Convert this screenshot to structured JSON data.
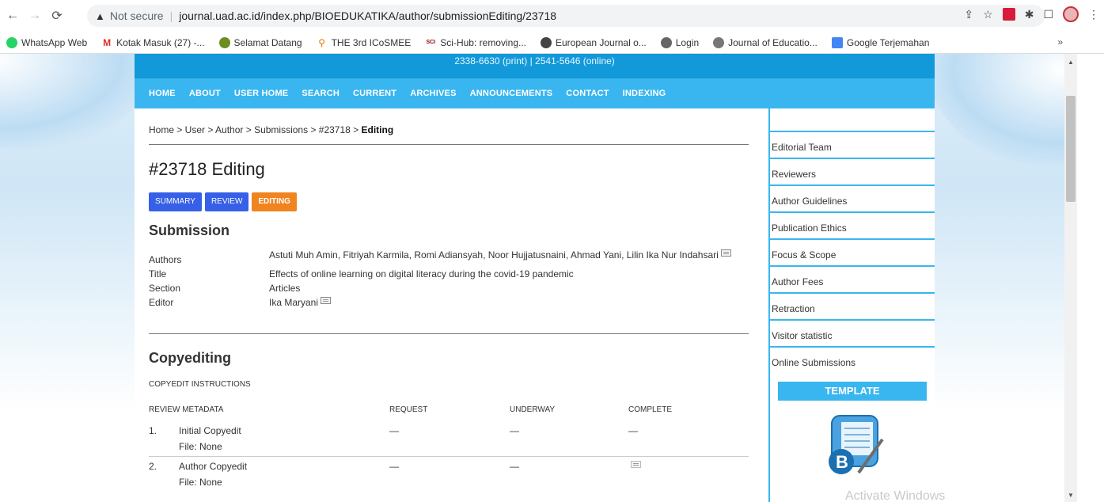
{
  "browser": {
    "security_warning": "Not secure",
    "url": "journal.uad.ac.id/index.php/BIOEDUKATIKA/author/submissionEditing/23718",
    "bookmarks": [
      "WhatsApp Web",
      "Kotak Masuk (27) -...",
      "Selamat Datang",
      "THE 3rd ICoSMEE",
      "Sci-Hub: removing...",
      "European Journal o...",
      "Login",
      "Journal of Educatio...",
      "Google Terjemahan"
    ],
    "more": "»"
  },
  "header": {
    "issn": "2338-6630 (print) | 2541-5646 (online)"
  },
  "nav": [
    "HOME",
    "ABOUT",
    "USER HOME",
    "SEARCH",
    "CURRENT",
    "ARCHIVES",
    "ANNOUNCEMENTS",
    "CONTACT",
    "INDEXING"
  ],
  "breadcrumb": {
    "path": "Home > User > Author > Submissions > #23718 > ",
    "current": "Editing"
  },
  "page_title": "#23718 Editing",
  "tabs": [
    "SUMMARY",
    "REVIEW",
    "EDITING"
  ],
  "submission": {
    "heading": "Submission",
    "authors_label": "Authors",
    "authors_value": "Astuti Muh Amin, Fitriyah Karmila, Romi Adiansyah, Noor Hujjatusnaini, Ahmad Yani, Lilin Ika Nur Indahsari",
    "title_label": "Title",
    "title_value": "Effects of online learning on digital literacy during the covid-19 pandemic",
    "section_label": "Section",
    "section_value": "Articles",
    "editor_label": "Editor",
    "editor_value": "Ika Maryani"
  },
  "copyediting": {
    "heading": "Copyediting",
    "instructions": "COPYEDIT INSTRUCTIONS",
    "col_review": "REVIEW METADATA",
    "col_request": "REQUEST",
    "col_underway": "UNDERWAY",
    "col_complete": "COMPLETE",
    "rows": [
      {
        "num": "1.",
        "name": "Initial Copyedit",
        "request": "—",
        "underway": "—",
        "complete": "—",
        "file": "File: None"
      },
      {
        "num": "2.",
        "name": "Author Copyedit",
        "request": "—",
        "underway": "—",
        "complete": "",
        "file": "File: None"
      }
    ]
  },
  "sidebar": {
    "items": [
      "Editorial Team",
      "Reviewers",
      "Author Guidelines",
      "Publication Ethics",
      "Focus & Scope",
      "Author Fees",
      "Retraction",
      "Visitor statistic",
      "Online Submissions"
    ],
    "template_label": "TEMPLATE"
  },
  "watermark": "Activate Windows"
}
